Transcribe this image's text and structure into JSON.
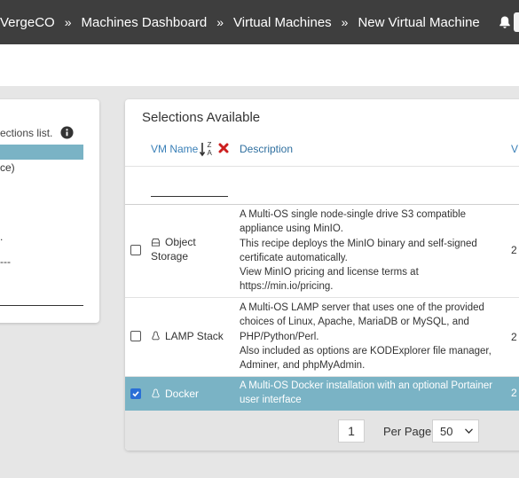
{
  "topbar": {
    "breadcrumbs": [
      "VergeCO",
      "Machines Dashboard",
      "Virtual Machines",
      "New Virtual Machine"
    ],
    "separator": "»"
  },
  "left_panel": {
    "hint_fragment": "ections list.",
    "fragments": [
      "ce)",
      ".",
      "---"
    ]
  },
  "selections": {
    "title": "Selections Available",
    "columns": {
      "name": "VM Name",
      "description": "Description",
      "truncated": "V"
    },
    "filter_value": "",
    "rows": [
      {
        "name_lines": [
          "Object",
          "Storage"
        ],
        "icon": "database-icon",
        "checked": false,
        "version_fragment": "2",
        "description_lines": [
          "A Multi-OS single node-single drive S3 compatible",
          "appliance using MinIO.",
          "This recipe deploys the MinIO binary and self-signed",
          "certificate automatically.",
          "View MinIO pricing and license terms at",
          "https://min.io/pricing."
        ]
      },
      {
        "name_lines": [
          "LAMP Stack"
        ],
        "icon": "linux-icon",
        "checked": false,
        "version_fragment": "2",
        "description_lines": [
          "A Multi-OS LAMP server that uses one of the provided",
          "choices of Linux, Apache, MariaDB or MySQL, and",
          "PHP/Python/Perl.",
          "Also included as options are KODExplorer file manager,",
          "Adminer, and phpMyAdmin."
        ]
      },
      {
        "name_lines": [
          "Docker"
        ],
        "icon": "linux-icon",
        "checked": true,
        "version_fragment": "2",
        "description_lines": [
          "A Multi-OS Docker installation with an optional Portainer",
          "user interface"
        ]
      }
    ]
  },
  "pagination": {
    "page": "1",
    "per_page_label": "Per Page:",
    "per_page_value": "50"
  },
  "colors": {
    "topbar": "#3e3e3e",
    "selected_row": "#7ab3c5",
    "link": "#3a80b8",
    "clear_icon": "#cc1f1f"
  }
}
